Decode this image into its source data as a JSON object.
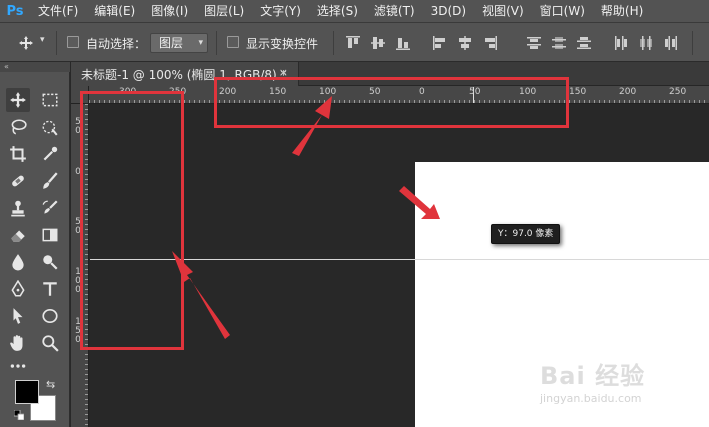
{
  "app": {
    "logo": "Ps"
  },
  "menu": [
    "文件(F)",
    "编辑(E)",
    "图像(I)",
    "图层(L)",
    "文字(Y)",
    "选择(S)",
    "滤镜(T)",
    "3D(D)",
    "视图(V)",
    "窗口(W)",
    "帮助(H)"
  ],
  "options": {
    "auto_select_label": "自动选择：",
    "auto_select_checked": false,
    "auto_select_value": "图层",
    "show_transform_label": "显示变换控件",
    "show_transform_checked": false
  },
  "toolbar": {
    "collapse_label": "«"
  },
  "document": {
    "tab_label": "未标题-1 @ 100% (椭圆 1, RGB/8) *",
    "close_label": "×"
  },
  "ruler_h_labels": [
    "300",
    "250",
    "200",
    "150",
    "100",
    "50",
    "0",
    "50",
    "100",
    "150",
    "200",
    "250"
  ],
  "ruler_v_labels": [
    "50",
    "0",
    "50",
    "100",
    "150"
  ],
  "guide": {
    "tooltip": "Y：97.0 像素"
  },
  "colors": {
    "foreground": "#000000",
    "background": "#ffffff",
    "annotation": "#e0343c",
    "accent": "#31a8ff"
  },
  "watermark": {
    "text": "Bai 经验",
    "url": "jingyan.baidu.com"
  }
}
